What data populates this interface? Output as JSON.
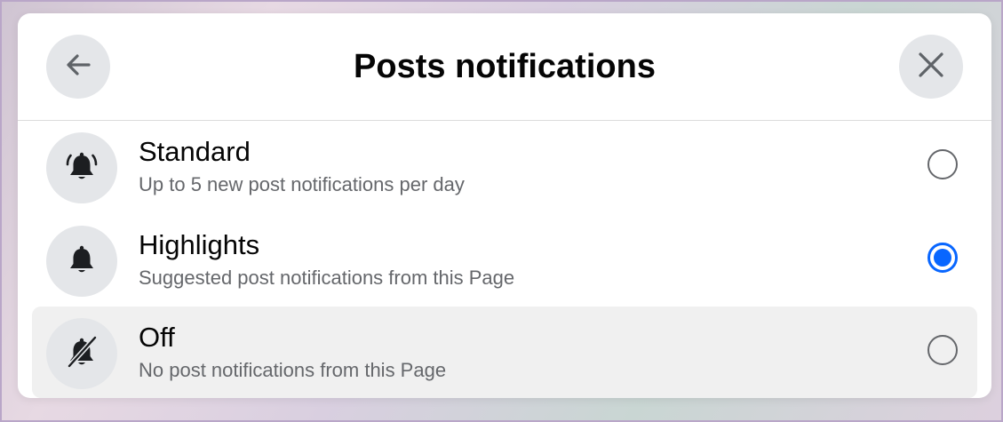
{
  "dialog": {
    "title": "Posts notifications",
    "back_icon": "arrow-left-icon",
    "close_icon": "close-icon"
  },
  "options": [
    {
      "title": "Standard",
      "description": "Up to 5 new post notifications per day",
      "icon": "bell-ringing-icon",
      "selected": false
    },
    {
      "title": "Highlights",
      "description": "Suggested post notifications from this Page",
      "icon": "bell-icon",
      "selected": true
    },
    {
      "title": "Off",
      "description": "No post notifications from this Page",
      "icon": "bell-off-icon",
      "selected": false
    }
  ],
  "colors": {
    "accent": "#0866ff",
    "icon_bg": "#e4e6e9",
    "text_primary": "#050505",
    "text_secondary": "#65676b",
    "row_highlight": "#f0f0f0"
  }
}
